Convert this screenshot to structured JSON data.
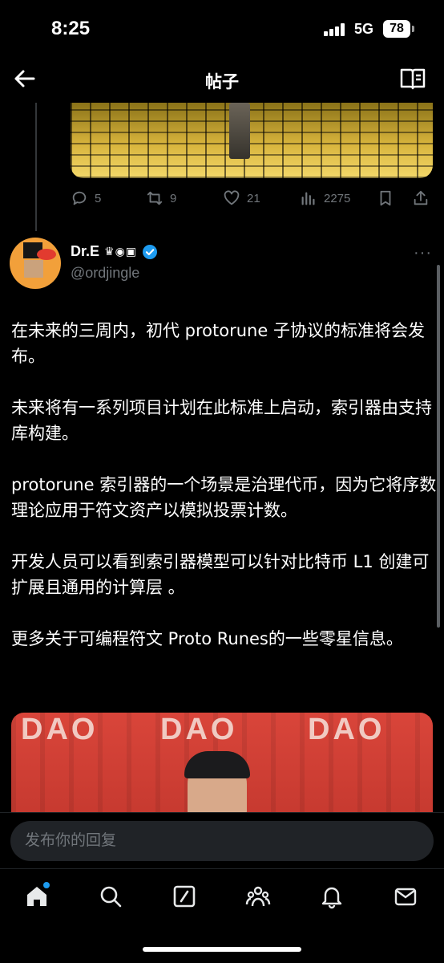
{
  "status_bar": {
    "time": "8:25",
    "network": "5G",
    "battery": "78"
  },
  "header": {
    "title": "帖子",
    "back_icon": "arrow-left-icon",
    "reader_icon": "book-open-icon"
  },
  "previous_post": {
    "stats": {
      "replies": "5",
      "reposts": "9",
      "likes": "21",
      "views": "2275"
    }
  },
  "post": {
    "author_name": "Dr.E",
    "author_badges": "♛◉▣",
    "handle": "@ordjingle",
    "more_label": "···",
    "paragraphs": [
      "在未来的三周内，初代 protorune 子协议的标准将会发布。",
      "未来将有一系列项目计划在此标准上启动，索引器由支持库构建。",
      "protorune 索引器的一个场景是治理代币，因为它将序数理论应用于符文资产以模拟投票计数。",
      "开发人员可以看到索引器模型可以针对比特币 L1 创建可扩展且通用的计算层 。",
      "更多关于可编程符文 Proto Runes的一些零星信息。"
    ],
    "image_text": "DAO"
  },
  "reply": {
    "placeholder": "发布你的回复"
  },
  "nav": [
    "home-icon",
    "search-icon",
    "compose-icon",
    "communities-icon",
    "notifications-icon",
    "messages-icon"
  ],
  "colors": {
    "accent": "#1d9bf0",
    "muted": "#71767b",
    "background": "#000000"
  }
}
